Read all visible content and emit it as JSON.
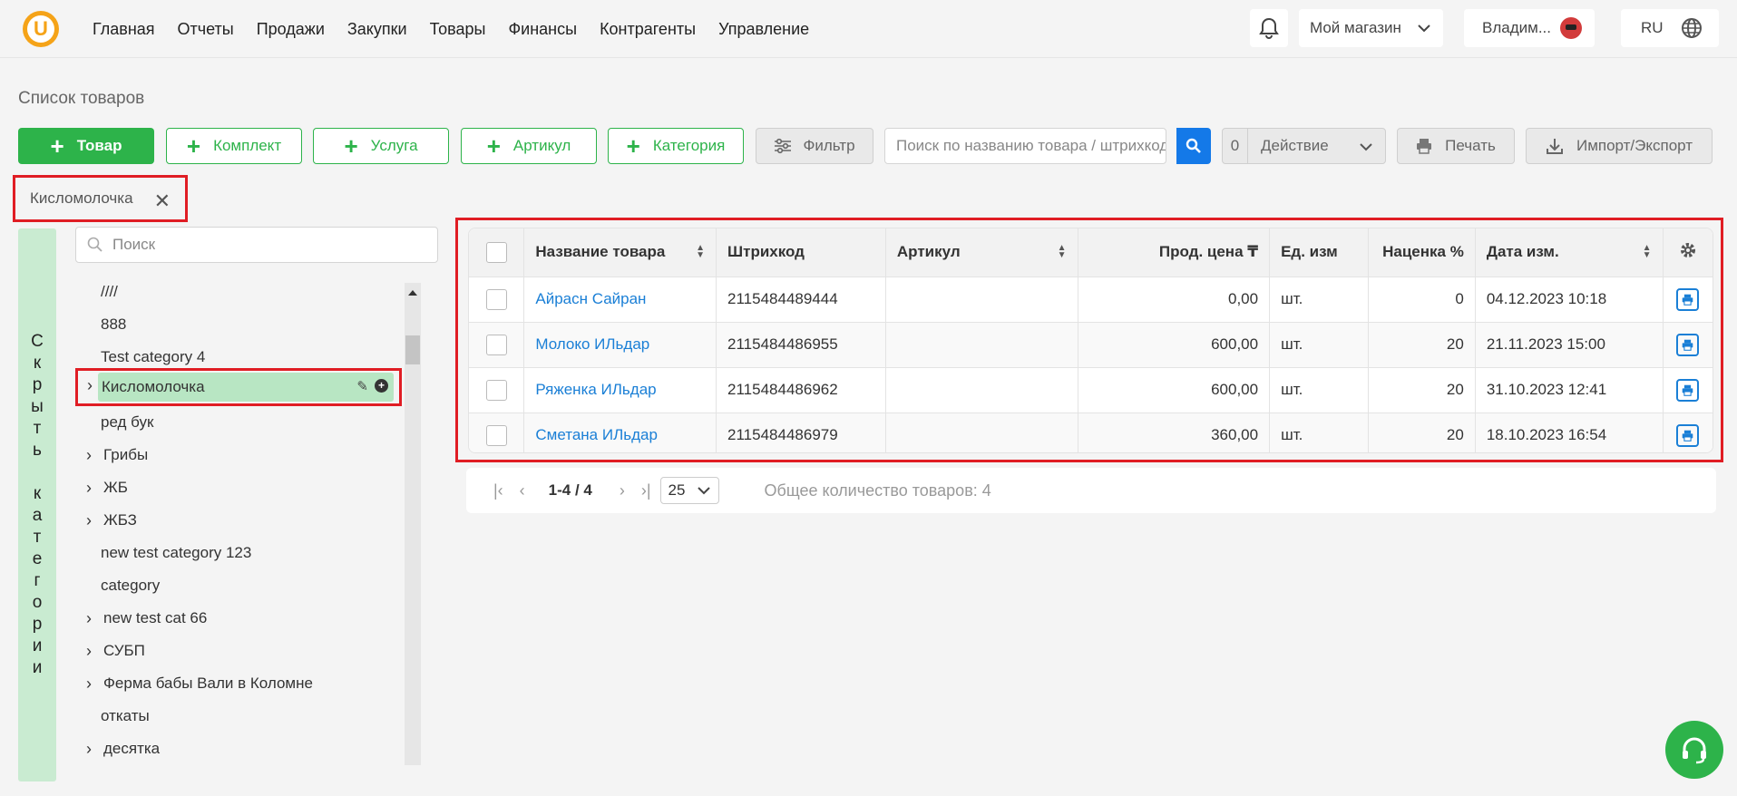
{
  "nav": {
    "logo": "U",
    "items": [
      "Главная",
      "Отчеты",
      "Продажи",
      "Закупки",
      "Товары",
      "Финансы",
      "Контрагенты",
      "Управление"
    ],
    "store": "Мой магазин",
    "user": "Владим...",
    "lang": "RU"
  },
  "page_title": "Список товаров",
  "toolbar": {
    "product": "Товар",
    "kit": "Комплект",
    "service": "Услуга",
    "article": "Артикул",
    "category": "Категория",
    "filter": "Фильтр",
    "search_placeholder": "Поиск по названию товара / штрихкоду",
    "action_count": "0",
    "action": "Действие",
    "print": "Печать",
    "import_export": "Импорт/Экспорт"
  },
  "active_tag": "Кисломолочка",
  "sidebar": {
    "hide_label": [
      "С",
      "к",
      "р",
      "ы",
      "т",
      "ь",
      "",
      "к",
      "а",
      "т",
      "е",
      "г",
      "о",
      "р",
      "и",
      "и"
    ],
    "search_placeholder": "Поиск",
    "categories": [
      {
        "label": "////",
        "arrow": false
      },
      {
        "label": "888",
        "arrow": false
      },
      {
        "label": "Test category 4",
        "arrow": false
      },
      {
        "label": "Кисломолочка",
        "arrow": true,
        "selected": true
      },
      {
        "label": "ред бук",
        "arrow": false
      },
      {
        "label": "Грибы",
        "arrow": true
      },
      {
        "label": "ЖБ",
        "arrow": true
      },
      {
        "label": "ЖБЗ",
        "arrow": true
      },
      {
        "label": "new test category 123",
        "arrow": false
      },
      {
        "label": "category",
        "arrow": false
      },
      {
        "label": "new test cat 66",
        "arrow": true
      },
      {
        "label": "СУБП",
        "arrow": true
      },
      {
        "label": "Ферма бабы Вали в Коломне",
        "arrow": true
      },
      {
        "label": "откаты",
        "arrow": false
      },
      {
        "label": "десятка",
        "arrow": true
      }
    ]
  },
  "table": {
    "headers": {
      "name": "Название товара",
      "barcode": "Штрихкод",
      "article": "Артикул",
      "price": "Прод. цена ₸",
      "unit": "Ед. изм",
      "markup": "Наценка %",
      "date": "Дата изм."
    },
    "rows": [
      {
        "name": "Айрасн Сайран",
        "barcode": "2115484489444",
        "article": "",
        "price": "0,00",
        "unit": "шт.",
        "markup": "0",
        "date": "04.12.2023 10:18"
      },
      {
        "name": "Молоко ИЛьдар",
        "barcode": "2115484486955",
        "article": "",
        "price": "600,00",
        "unit": "шт.",
        "markup": "20",
        "date": "21.11.2023 15:00"
      },
      {
        "name": "Ряженка ИЛьдар",
        "barcode": "2115484486962",
        "article": "",
        "price": "600,00",
        "unit": "шт.",
        "markup": "20",
        "date": "31.10.2023 12:41"
      },
      {
        "name": "Сметана ИЛьдар",
        "barcode": "2115484486979",
        "article": "",
        "price": "360,00",
        "unit": "шт.",
        "markup": "20",
        "date": "18.10.2023 16:54"
      }
    ]
  },
  "pager": {
    "range": "1-4 / 4",
    "page_size": "25",
    "total": "Общее количество товаров: 4"
  },
  "colors": {
    "accent": "#2db34a",
    "link": "#1a7fd6",
    "highlight": "#e01d24"
  }
}
